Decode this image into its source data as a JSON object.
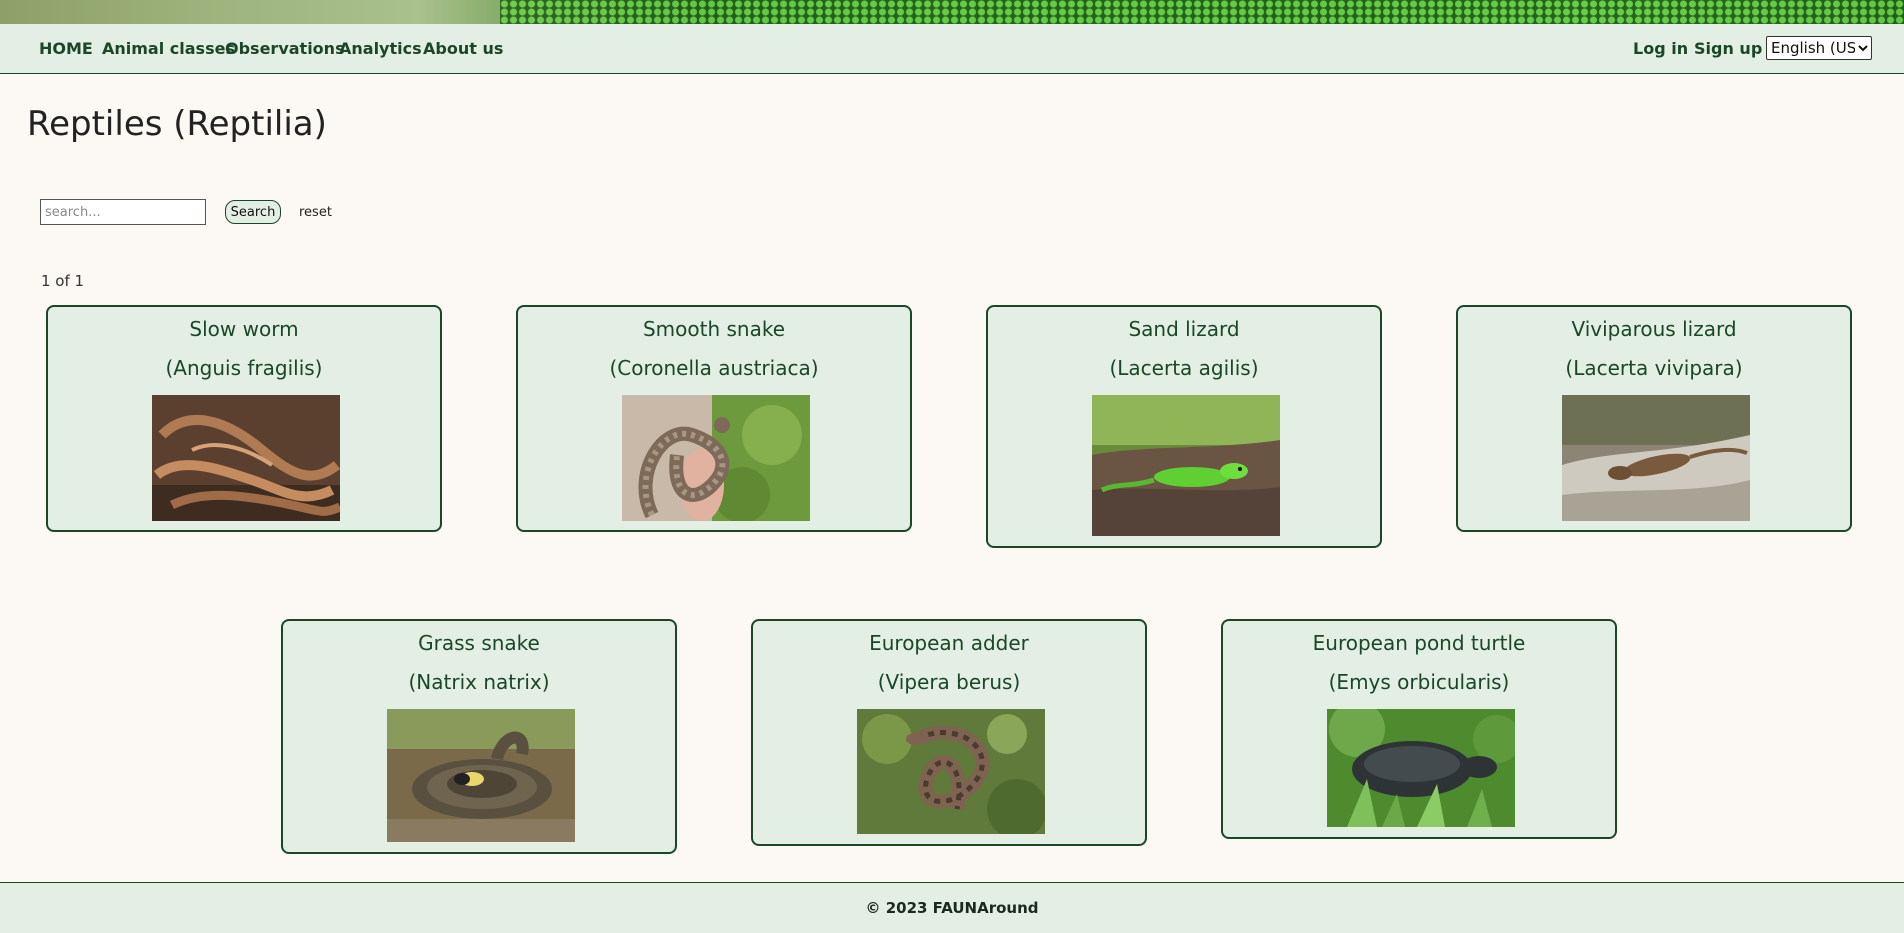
{
  "nav": {
    "home": "HOME",
    "animal_classes": "Animal classes",
    "observations": "Observations",
    "analytics": "Analytics",
    "about": "About us",
    "login": "Log in",
    "signup": "Sign up",
    "language": "English (US)"
  },
  "page": {
    "title": "Reptiles (Reptilia)"
  },
  "search": {
    "placeholder": "search...",
    "button": "Search",
    "reset": "reset"
  },
  "pagination": {
    "text": "1 of 1"
  },
  "animals": [
    {
      "name": "Slow worm",
      "latin": "(Anguis fragilis)",
      "photo": "slow-worm-photo"
    },
    {
      "name": "Smooth snake",
      "latin": "(Coronella austriaca)",
      "photo": "smooth-snake-photo"
    },
    {
      "name": "Sand lizard",
      "latin": "(Lacerta agilis)",
      "photo": "sand-lizard-photo"
    },
    {
      "name": "Viviparous lizard",
      "latin": "(Lacerta vivipara)",
      "photo": "viviparous-lizard-photo"
    },
    {
      "name": "Grass snake",
      "latin": "(Natrix natrix)",
      "photo": "grass-snake-photo"
    },
    {
      "name": "European adder",
      "latin": "(Vipera berus)",
      "photo": "european-adder-photo"
    },
    {
      "name": "European pond turtle",
      "latin": "(Emys orbicularis)",
      "photo": "pond-turtle-photo"
    }
  ],
  "footer": {
    "text": "© 2023 FAUNAround"
  },
  "colors": {
    "accent": "#1b4726",
    "panel": "#e3efe5",
    "background": "#fcf8f4"
  }
}
